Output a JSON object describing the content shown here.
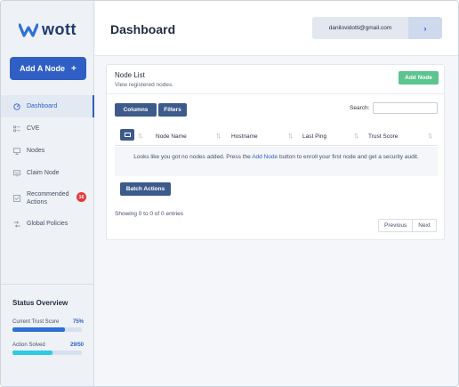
{
  "brand": {
    "name": "wott"
  },
  "sidebar": {
    "add_button": {
      "label": "Add A Node",
      "icon": "plus"
    },
    "items": [
      {
        "label": "Dashboard",
        "icon": "dashboard-icon",
        "active": true
      },
      {
        "label": "CVE",
        "icon": "list-icon"
      },
      {
        "label": "Nodes",
        "icon": "monitor-icon"
      },
      {
        "label": "Claim Node",
        "icon": "claim-icon"
      },
      {
        "label_line1": "Recommended",
        "label_line2": "Actions",
        "icon": "checkbox-icon",
        "badge": "16"
      },
      {
        "label": "Global Policies",
        "icon": "shuffle-icon"
      }
    ]
  },
  "status": {
    "title": "Status Overview",
    "trust": {
      "label": "Current Trust Score",
      "value": "75%",
      "fraction": 0.75,
      "color": "#2f6fd6"
    },
    "actions": {
      "label": "Action Solved",
      "value": "29/50",
      "fraction": 0.58,
      "color": "#2dcbe3"
    }
  },
  "header": {
    "title": "Dashboard",
    "user_email": "danilovidotti@gmail.com",
    "arrow": "›"
  },
  "card": {
    "title": "Node List",
    "subtitle": "View registered nodes.",
    "add_node": "Add Node",
    "columns_btn": "Columns",
    "filters_btn": "Filters",
    "search_label": "Search:",
    "search_value": "",
    "columns": [
      "Node Name",
      "Hostname",
      "Last Ping",
      "Trust Score"
    ],
    "empty_pre": "Looks like you got no nodes added. Press the",
    "empty_link": "Add Node",
    "empty_post": "button to enroll your first node and get a security audit.",
    "batch_actions": "Batch Actions",
    "entries": "Showing 0 to 0 of 0 entries",
    "previous": "Previous",
    "next": "Next"
  },
  "colors": {
    "accent": "#2f5fc4",
    "green": "#5cc48d",
    "badge": "#e23b3b",
    "dark_button": "#3c5a8a"
  }
}
